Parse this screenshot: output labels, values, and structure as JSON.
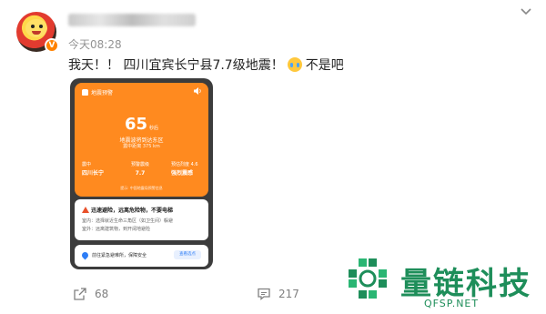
{
  "post": {
    "timestamp": "今天08:28",
    "text_main": "我天！！ 四川宜宾长宁县7.7级地震！",
    "text_tail": "不是吧",
    "emoji_icon": "crying-face-emoji",
    "verified_badge": "V"
  },
  "alert_screenshot": {
    "header_label": "地震预警",
    "countdown_value": "65",
    "countdown_unit": "秒后",
    "title": "地震波将到达东区",
    "distance": "震中距离 375 km",
    "epicenter_label": "震中",
    "epicenter_value": "四川长宁",
    "magnitude_label": "预警震级",
    "magnitude_value": "7.7",
    "intensity_label": "预估烈度 4.6",
    "intensity_value": "强烈震感",
    "footer_note": "提示: 中国地震局预警信息",
    "advice_heading": "迅速避险，远离危险物，不要电梯",
    "advice_line1": "室内：选择就近生命三角区（如卫生间）躲避",
    "advice_line2": "室外：远离建筑物，到开阔地避险",
    "shelter_text": "前往紧急避难所，保障安全",
    "shelter_button": "查看选点"
  },
  "actions": {
    "share_count": "68",
    "comment_count": "217"
  },
  "watermark": {
    "name": "量链科技",
    "url": "QFSP.NET"
  },
  "colors": {
    "alert_orange": "#ff8a1f",
    "weibo_orange": "#ff8200",
    "watermark_green": "#1e8e5a"
  }
}
